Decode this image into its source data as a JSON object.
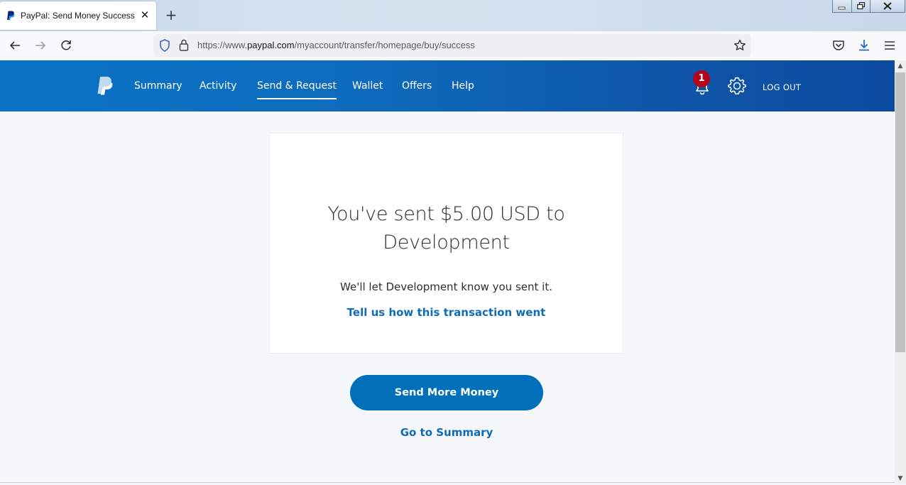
{
  "browser": {
    "tab_title": "PayPal: Send Money Success",
    "url_prefix": "https://www.",
    "url_host": "paypal.com",
    "url_path": "/myaccount/transfer/homepage/buy/success"
  },
  "header": {
    "nav": [
      {
        "label": "Summary"
      },
      {
        "label": "Activity"
      },
      {
        "label": "Send & Request"
      },
      {
        "label": "Wallet"
      },
      {
        "label": "Offers"
      },
      {
        "label": "Help"
      }
    ],
    "active_nav": "Send & Request",
    "notification_count": "1",
    "logout_label": "LOG OUT"
  },
  "main": {
    "headline": "You've sent $5.00 USD to Development",
    "subtext": "We'll let Development know you sent it.",
    "feedback_link": "Tell us how this transaction went",
    "send_more_button": "Send More Money",
    "summary_link": "Go to Summary"
  },
  "colors": {
    "header_blue": "#0d6bbd",
    "button_blue": "#0070ba",
    "link_blue": "#0e6cb8",
    "badge_red": "#b3061a"
  }
}
